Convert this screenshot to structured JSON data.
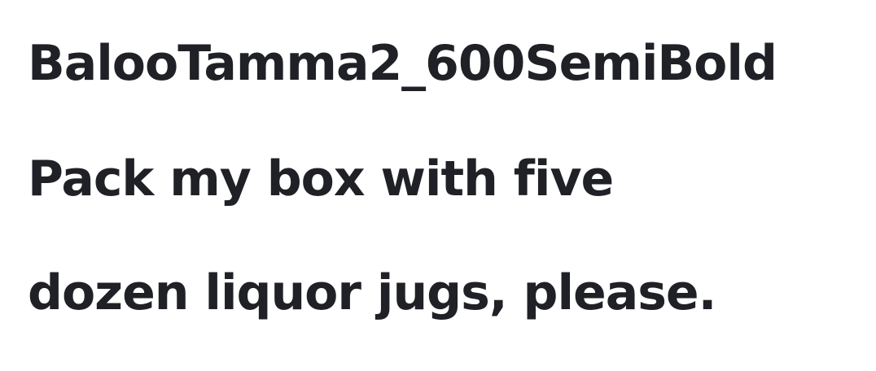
{
  "lines": [
    "BalooTamma2_600SemiBold",
    "Pack my box with five",
    "dozen liquor jugs, please."
  ],
  "colors": {
    "text": "#1f2126",
    "background": "#ffffff"
  }
}
